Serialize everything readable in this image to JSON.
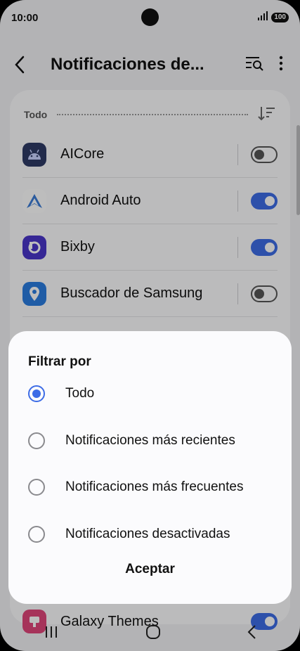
{
  "status_bar": {
    "time": "10:00",
    "battery": "100"
  },
  "app_bar": {
    "title": "Notificaciones de..."
  },
  "filter": {
    "label": "Todo"
  },
  "apps": [
    {
      "name": "AICore",
      "enabled": false,
      "icon": "android-icon"
    },
    {
      "name": "Android Auto",
      "enabled": true,
      "icon": "android-auto-icon"
    },
    {
      "name": "Bixby",
      "enabled": true,
      "icon": "bixby-icon"
    },
    {
      "name": "Buscador de Samsung",
      "enabled": false,
      "icon": "location-icon"
    }
  ],
  "partial_app": {
    "name": "Galaxy Themes",
    "enabled": true,
    "icon": "galaxy-themes-icon"
  },
  "sheet": {
    "title": "Filtrar por",
    "options": [
      {
        "label": "Todo",
        "selected": true
      },
      {
        "label": "Notificaciones más recientes",
        "selected": false
      },
      {
        "label": "Notificaciones más frecuentes",
        "selected": false
      },
      {
        "label": "Notificaciones desactivadas",
        "selected": false
      }
    ],
    "accept_label": "Aceptar"
  },
  "colors": {
    "accent": "#3d6ce6",
    "background": "#f2f2f4"
  }
}
